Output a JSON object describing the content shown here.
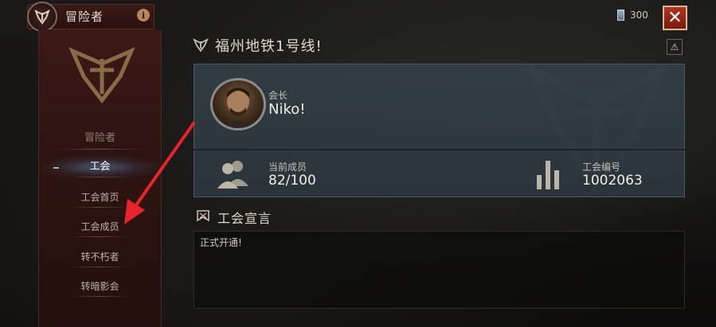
{
  "window": {
    "title": "冒险者"
  },
  "left_panel": {
    "section_label": "冒险者",
    "nav": [
      {
        "label": "工会",
        "active": true
      },
      {
        "label": "工会首页",
        "active": false
      },
      {
        "label": "工会成员",
        "active": false
      },
      {
        "label": "转不朽者",
        "active": false
      },
      {
        "label": "转暗影会",
        "active": false
      }
    ]
  },
  "topbar": {
    "currency": "300",
    "close_icon": "close-icon"
  },
  "guild": {
    "name": "福州地铁1号线!",
    "leader_role": "会长",
    "leader_name": "Niko!",
    "members_label": "当前成员",
    "members_value": "82/100",
    "guild_id_label": "工会编号",
    "guild_id_value": "1002063",
    "declaration_title": "工会宣言",
    "declaration_text": "正式开通!"
  },
  "colors": {
    "accent_red": "#9a2a18",
    "close_button": "#b0331e",
    "annotation_arrow": "#e8242a"
  }
}
